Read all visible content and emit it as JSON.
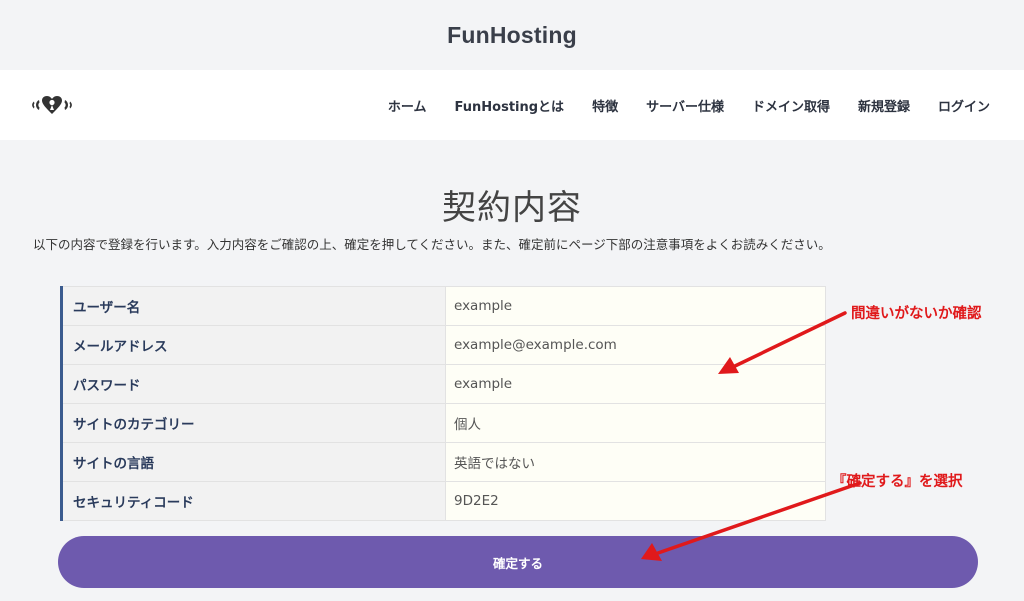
{
  "site": {
    "title": "FunHosting"
  },
  "nav": {
    "items": [
      "ホーム",
      "FunHostingとは",
      "特徴",
      "サーバー仕様",
      "ドメイン取得",
      "新規登録",
      "ログイン"
    ]
  },
  "page": {
    "heading": "契約内容",
    "intro": "以下の内容で登録を行います。入力内容をご確認の上、確定を押してください。また、確定前にページ下部の注意事項をよくお読みください。"
  },
  "table": {
    "rows": [
      {
        "label": "ユーザー名",
        "value": "example"
      },
      {
        "label": "メールアドレス",
        "value": "example@example.com"
      },
      {
        "label": "パスワード",
        "value": "example"
      },
      {
        "label": "サイトのカテゴリー",
        "value": "個人"
      },
      {
        "label": "サイトの言語",
        "value": "英語ではない"
      },
      {
        "label": "セキュリティコード",
        "value": "9D2E2"
      }
    ]
  },
  "confirm_button": {
    "label": "確定する"
  },
  "annotations": {
    "check_note": "間違いがないか確認",
    "select_note": "『確定する』を選択"
  },
  "colors": {
    "accent": "#6e5aae",
    "annotation": "#e0191b",
    "row_border": "#3b5b8e"
  }
}
